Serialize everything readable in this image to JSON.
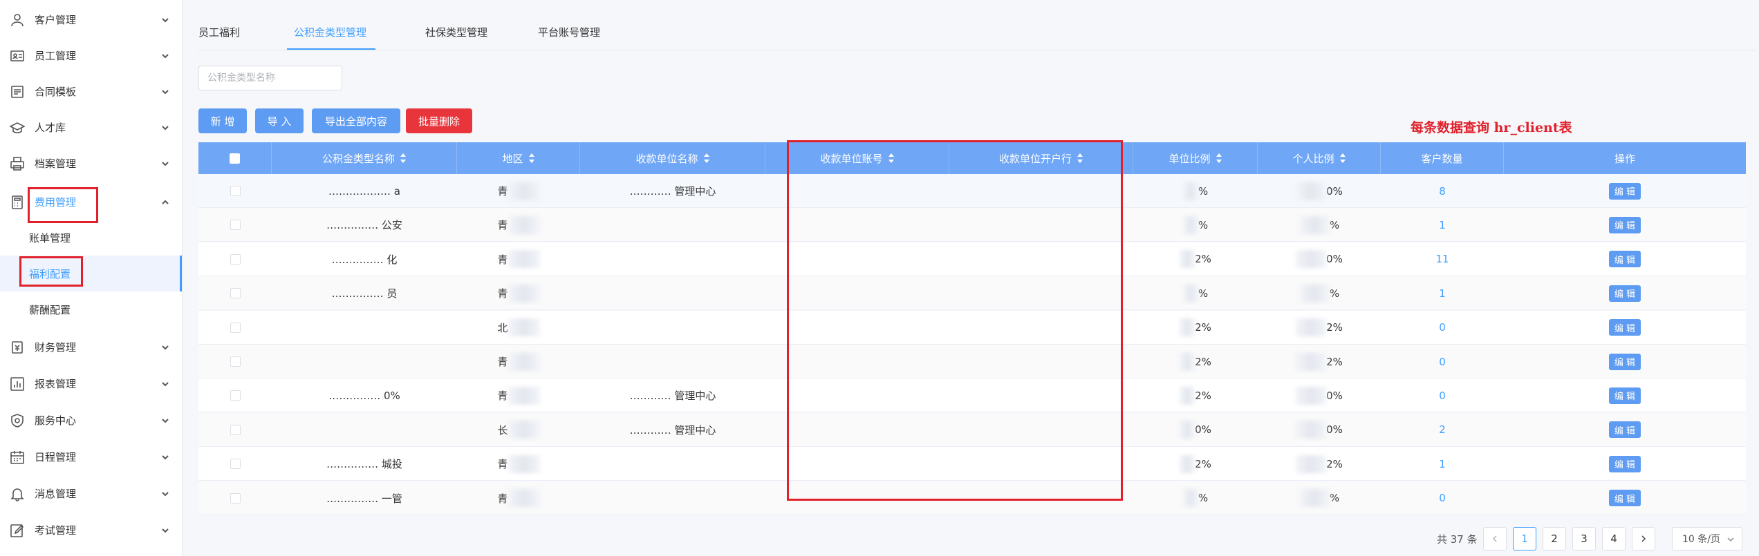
{
  "sidebar": {
    "menu": [
      {
        "label": "客户管理",
        "icon": "user-icon"
      },
      {
        "label": "员工管理",
        "icon": "id-card-icon"
      },
      {
        "label": "合同模板",
        "icon": "document-icon"
      },
      {
        "label": "人才库",
        "icon": "graduation-cap-icon"
      },
      {
        "label": "档案管理",
        "icon": "printer-icon"
      },
      {
        "label": "费用管理",
        "icon": "calculator-icon"
      },
      {
        "label": "财务管理",
        "icon": "wallet-icon"
      },
      {
        "label": "报表管理",
        "icon": "bar-chart-icon"
      },
      {
        "label": "服务中心",
        "icon": "service-icon"
      },
      {
        "label": "日程管理",
        "icon": "calendar-icon"
      },
      {
        "label": "消息管理",
        "icon": "bell-icon"
      },
      {
        "label": "考试管理",
        "icon": "edit-icon"
      }
    ],
    "submenu": [
      "账单管理",
      "福利配置",
      "薪酬配置"
    ]
  },
  "tabs": [
    "员工福利",
    "公积金类型管理",
    "社保类型管理",
    "平台账号管理"
  ],
  "search": {
    "placeholder": "公积金类型名称"
  },
  "buttons": {
    "add": "新 增",
    "import": "导 入",
    "export": "导出全部内容",
    "batch_delete": "批量删除"
  },
  "note": "每条数据查询 hr_client表",
  "table": {
    "headers": [
      "公积金类型名称",
      "地区",
      "收款单位名称",
      "收款单位账号",
      "收款单位开户行",
      "单位比例",
      "个人比例",
      "客户数量",
      "操作"
    ],
    "rows": [
      {
        "name": "……………… a",
        "region": "青",
        "payee": "………… 管理中心",
        "unit_ratio": "%",
        "personal_ratio": "0%",
        "clients": "8"
      },
      {
        "name": "…………… 公安",
        "region": "青",
        "payee": "",
        "unit_ratio": "%",
        "personal_ratio": "%",
        "clients": "1"
      },
      {
        "name": "…………… 化",
        "region": "青",
        "payee": "",
        "unit_ratio": "2%",
        "personal_ratio": "0%",
        "clients": "11"
      },
      {
        "name": "…………… 员",
        "region": "青",
        "payee": "",
        "unit_ratio": "%",
        "personal_ratio": "%",
        "clients": "1"
      },
      {
        "name": "",
        "region": "北",
        "payee": "",
        "unit_ratio": "2%",
        "personal_ratio": "2%",
        "clients": "0"
      },
      {
        "name": "",
        "region": "青",
        "payee": "",
        "unit_ratio": "2%",
        "personal_ratio": "2%",
        "clients": "0"
      },
      {
        "name": "…………… 0%",
        "region": "青",
        "payee": "………… 管理中心",
        "unit_ratio": "2%",
        "personal_ratio": "0%",
        "clients": "0"
      },
      {
        "name": "",
        "region": "长",
        "payee": "………… 管理中心",
        "unit_ratio": "0%",
        "personal_ratio": "0%",
        "clients": "2"
      },
      {
        "name": "…………… 城投",
        "region": "青",
        "payee": "",
        "unit_ratio": "2%",
        "personal_ratio": "2%",
        "clients": "1"
      },
      {
        "name": "…………… 一管",
        "region": "青",
        "payee": "",
        "unit_ratio": "%",
        "personal_ratio": "%",
        "clients": "0"
      }
    ],
    "edit_label": "编 辑"
  },
  "pagination": {
    "total": "共 37 条",
    "pages": [
      "1",
      "2",
      "3",
      "4"
    ],
    "current": "1",
    "page_size": "10 条/页"
  },
  "colors": {
    "accent": "#409eff",
    "header_bg": "#6fa6f5",
    "danger": "#e8343b",
    "annotation": "#e0202a"
  }
}
